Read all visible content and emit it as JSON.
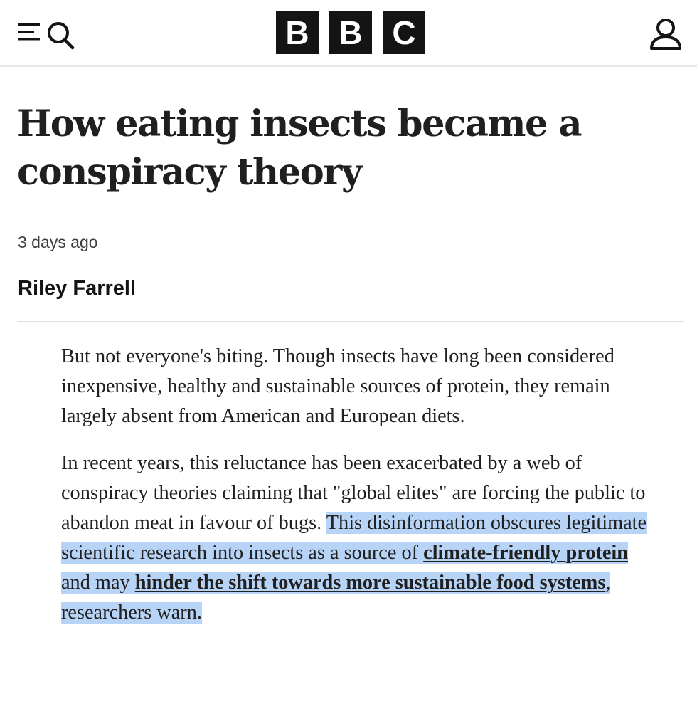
{
  "header": {
    "logo_letters": [
      "B",
      "B",
      "C"
    ],
    "menu_icon": "menu-icon",
    "search_icon": "search-icon",
    "account_icon": "account-icon"
  },
  "article": {
    "headline": "How eating insects became a conspiracy theory",
    "timestamp": "3 days ago",
    "author": "Riley Farrell",
    "paragraph1": "But not everyone's biting. Though insects have long been considered inexpensive, healthy and sustainable sources of protein, they remain largely absent from American and European diets.",
    "paragraph2": {
      "text_start": "In recent years, this reluctance has been exacerbated by a web of conspiracy theories claiming that \"global elites\" are forcing the public to abandon meat in favour of bugs. ",
      "selected_start": "This disinformation obscures legitimate scientific research into insects as a source of ",
      "link1": "climate-friendly protein",
      "selected_mid": " and may ",
      "link2": "hinder the shift towards more sustainable food systems",
      "selected_end": ", researchers warn."
    }
  },
  "colors": {
    "selection": "#b7d3f5",
    "logo": "#141414",
    "text": "#202020"
  }
}
